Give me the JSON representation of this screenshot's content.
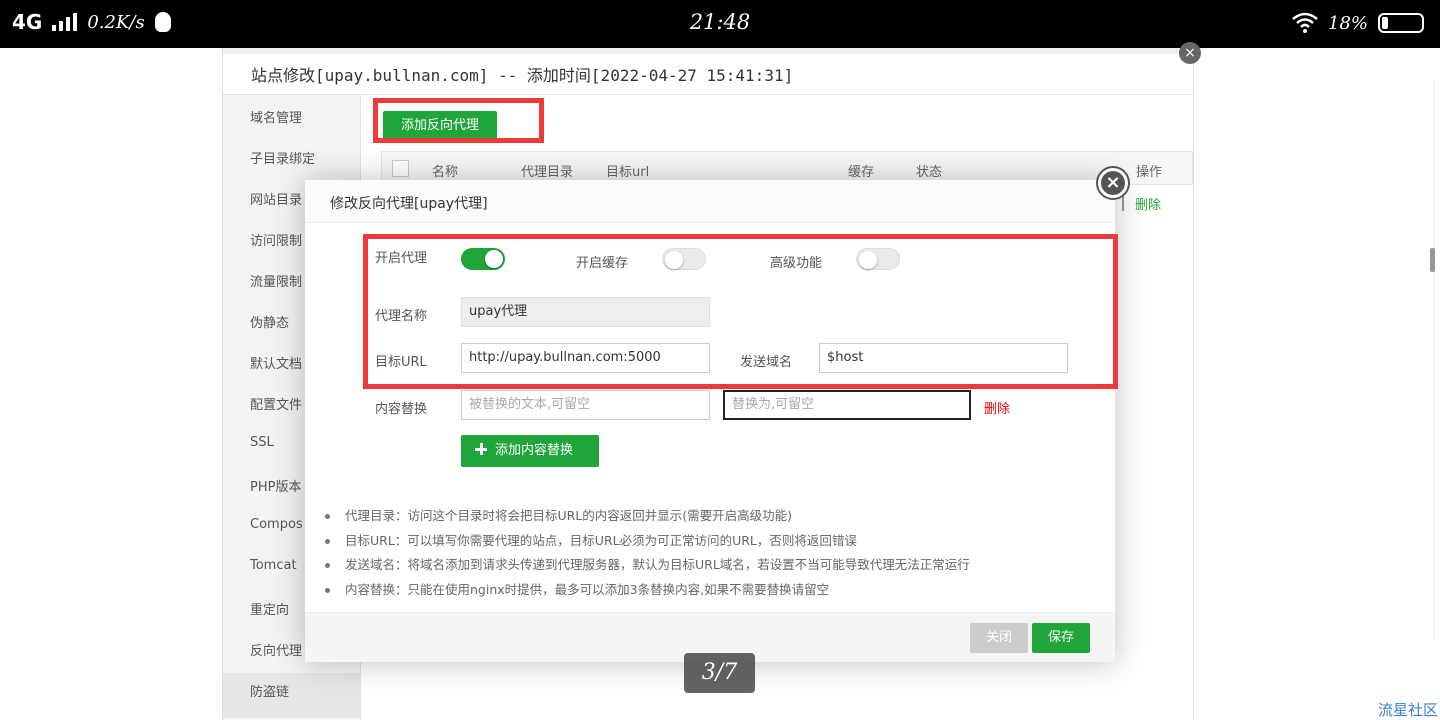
{
  "status_bar": {
    "network": "4G",
    "speed": "0.2K/s",
    "time": "21:48",
    "battery": "18%"
  },
  "bg_page": {
    "title": "站点修改[upay.bullnan.com] -- 添加时间[2022-04-27 15:41:31]",
    "sidebar": [
      "域名管理",
      "子目录绑定",
      "网站目录",
      "访问限制",
      "流量限制",
      "伪静态",
      "默认文档",
      "配置文件",
      "SSL",
      "PHP版本",
      "Compos",
      "Tomcat",
      "重定向",
      "反向代理",
      "防盗链"
    ],
    "add_button": "添加反向代理",
    "table_headers": [
      "名称",
      "代理目录",
      "目标url",
      "缓存",
      "状态",
      "操作"
    ],
    "row_delete": "删除"
  },
  "modal": {
    "title": "修改反向代理[upay代理]",
    "enable_proxy_label": "开启代理",
    "enable_cache_label": "开启缓存",
    "advanced_label": "高级功能",
    "proxy_name_label": "代理名称",
    "proxy_name_value": "upay代理",
    "target_url_label": "目标URL",
    "target_url_value": "http://upay.bullnan.com:5000",
    "send_domain_label": "发送域名",
    "send_domain_value": "$host",
    "content_replace_label": "内容替换",
    "replace_from_placeholder": "被替换的文本,可留空",
    "replace_to_placeholder": "替换为,可留空",
    "delete_link": "删除",
    "add_replace_button": "添加内容替换",
    "tips": [
      "代理目录：访问这个目录时将会把目标URL的内容返回并显示(需要开启高级功能)",
      "目标URL：可以填写你需要代理的站点，目标URL必须为可正常访问的URL，否则将返回错误",
      "发送域名：将域名添加到请求头传递到代理服务器，默认为目标URL域名，若设置不当可能导致代理无法正常运行",
      "内容替换：只能在使用nginx时提供，最多可以添加3条替换内容,如果不需要替换请留空"
    ],
    "close_button": "关闭",
    "save_button": "保存"
  },
  "toggles": {
    "enable_proxy": true,
    "enable_cache": false,
    "advanced": false
  },
  "page_indicator": "3/7",
  "watermark": "流星社区",
  "colors": {
    "accent_green": "#20a53a",
    "highlight_red": "#ed3a3a",
    "delete_red": "#ef0808"
  }
}
